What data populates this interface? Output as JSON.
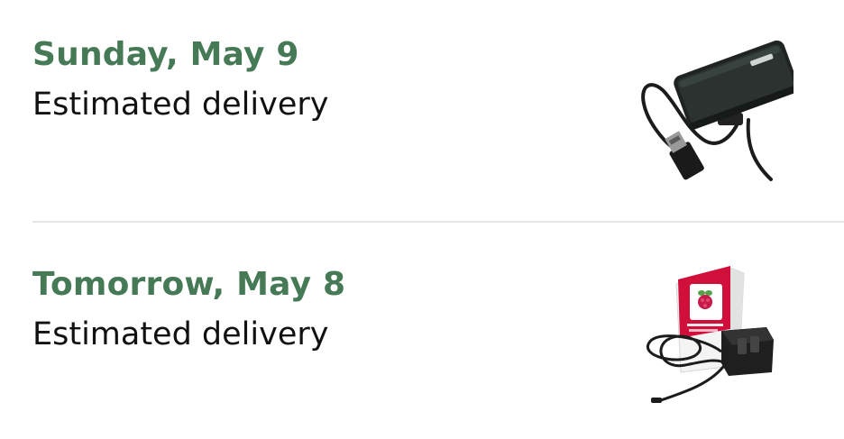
{
  "orders": [
    {
      "date": "Sunday, May 9",
      "status": "Estimated delivery",
      "image_icon": "external-drive-enclosure-with-usb-cable"
    },
    {
      "date": "Tomorrow, May 8",
      "status": "Estimated delivery",
      "image_icon": "raspberry-pi-power-supply-box"
    }
  ],
  "colors": {
    "date_text": "#467a57",
    "status_text": "#111111",
    "divider": "#e3e6e6",
    "brand_red": "#d0103a"
  }
}
